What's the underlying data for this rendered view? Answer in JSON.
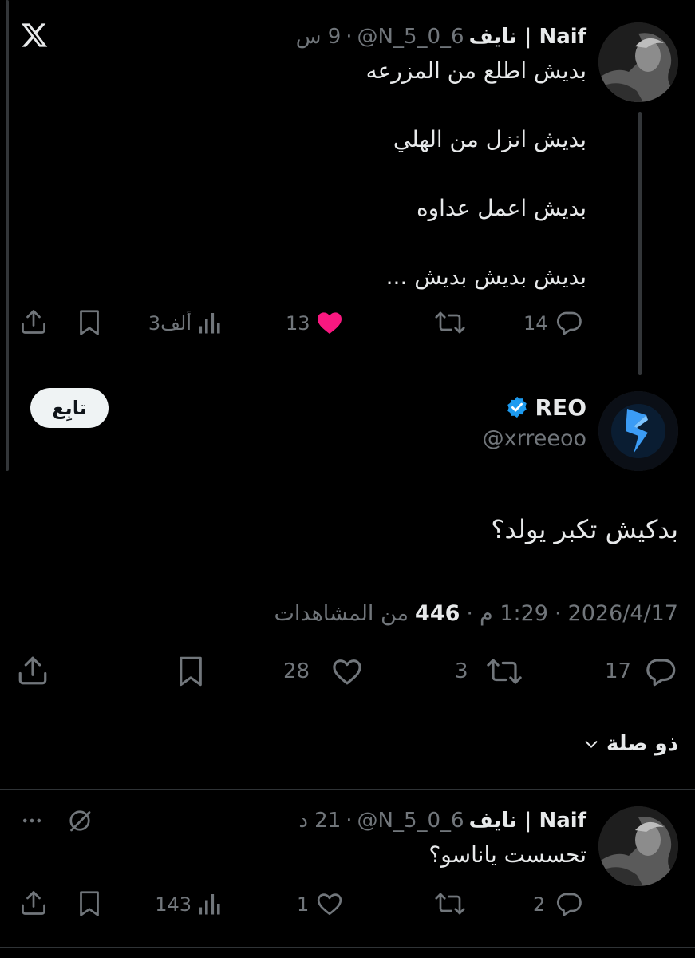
{
  "quoted_tweet": {
    "display_name": "نايف | Naif",
    "handle": "@N_5_0_6",
    "separator": "·",
    "time": "9 س",
    "lines": [
      "بديش اطلع من المزرعه",
      "بديش انزل من الهلي",
      "بديش اعمل عداوه",
      "بديش بديش بديش ..."
    ],
    "replies": "14",
    "likes": "13",
    "views": "3ألف"
  },
  "main_tweet": {
    "display_name": "REO",
    "handle": "@xrreeoo",
    "follow_label": "تابِع",
    "text": "بدكيش تكبر يولد؟",
    "date": "2026/4/17",
    "time": "1:29 م",
    "views_count": "446",
    "views_label": "من المشاهدات",
    "replies": "17",
    "retweets": "3",
    "likes": "28"
  },
  "related": {
    "label": "ذو صلة"
  },
  "reply_tweet": {
    "display_name": "نايف | Naif",
    "handle": "@N_5_0_6",
    "separator": "·",
    "time": "21 د",
    "text": "تحسست ياناسو؟",
    "replies": "2",
    "likes": "1",
    "views": "143"
  },
  "colors": {
    "background": "#000000",
    "text": "#e7e9ea",
    "muted": "#71767b",
    "like_active": "#f91880",
    "verified": "#1d9bf0"
  },
  "icons": [
    "x-logo-icon",
    "reply-icon",
    "retweet-icon",
    "heart-icon",
    "views-icon",
    "bookmark-icon",
    "share-icon",
    "verified-badge-icon",
    "chevron-down-icon",
    "grok-icon",
    "more-icon"
  ]
}
